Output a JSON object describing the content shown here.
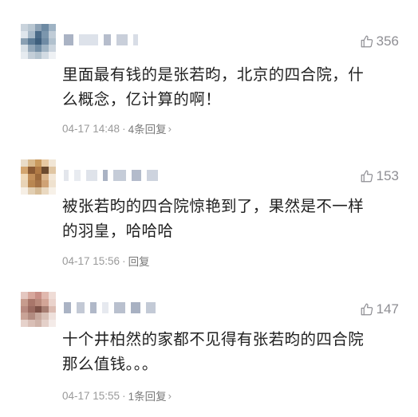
{
  "comments": [
    {
      "likes": "356",
      "text_line1": "里面最有钱的是张若昀，北京的四合院，什",
      "text_line2": "么概念，亿计算的啊！",
      "time": "04-17 14:48",
      "dot": "·",
      "replies": "4条回复",
      "chevron": "›",
      "avatar_colors": [
        "#c9d3dc",
        "#b8c6d1",
        "#8da2b5",
        "#6d8aa3",
        "#9fb3c4",
        "#dfe6ec",
        "#a7b9c8",
        "#4b6b88",
        "#7b96ad",
        "#c0ccd7",
        "#8aa0b3",
        "#5c7b96",
        "#3e5f7d",
        "#6f8ba4",
        "#b1c1ce",
        "#d8e0e7",
        "#93a8ba",
        "#728ea6",
        "#a0b4c4",
        "#cbd5de",
        "#e6ebf0",
        "#c3ced8",
        "#b4c3cf",
        "#d2dbe3",
        "#eef1f4"
      ]
    },
    {
      "likes": "153",
      "text_line1": "被张若昀的四合院惊艳到了，果然是不一样",
      "text_line2": "的羽皇，哈哈哈",
      "time": "04-17 15:56",
      "dot": "·",
      "replies": "回复",
      "chevron": "",
      "avatar_colors": [
        "#e9dcc8",
        "#d8b98c",
        "#c99a5e",
        "#e7c9a2",
        "#f1e6d6",
        "#d3a56f",
        "#8a5a34",
        "#b07a45",
        "#6b4a2e",
        "#e0c6a3",
        "#f0d9b8",
        "#c28f5a",
        "#9c6a3c",
        "#d9b48a",
        "#f3e7d7",
        "#e8d3b6",
        "#b98752",
        "#a57346",
        "#cfa275",
        "#efe2cf",
        "#f6efe5",
        "#e2cfb3",
        "#d7bd98",
        "#ead9c1",
        "#f7f1e8"
      ]
    },
    {
      "likes": "147",
      "text_line1": "十个井柏然的家都不见得有张若昀的四合院",
      "text_line2": "那么值钱。。。",
      "time": "04-17 15:55",
      "dot": "·",
      "replies": "1条回复",
      "chevron": "›",
      "avatar_colors": [
        "#e4c7c0",
        "#d7a79c",
        "#c98f86",
        "#e0b8ae",
        "#efdcd6",
        "#c79c8e",
        "#a8766a",
        "#b98a7c",
        "#d2a597",
        "#ead3cc",
        "#b88a80",
        "#9a6a60",
        "#7e5248",
        "#a77e72",
        "#dcbcb2",
        "#c9a397",
        "#b28b80",
        "#c7a89d",
        "#d8c0b6",
        "#efe1dc",
        "#e6d2cb",
        "#d9bfb6",
        "#cfb3a9",
        "#e4d0c9",
        "#f4ebe8"
      ]
    }
  ]
}
